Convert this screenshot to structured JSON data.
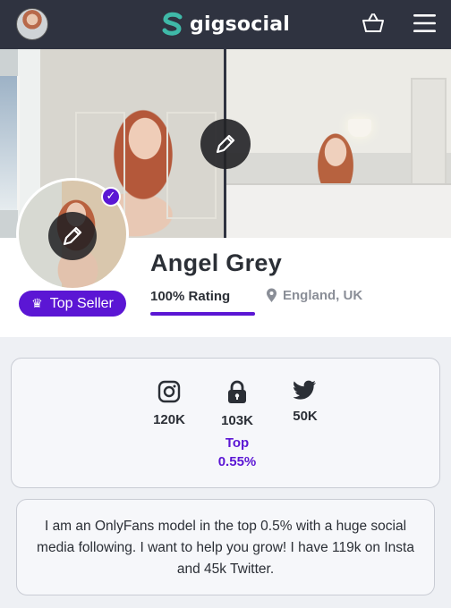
{
  "nav": {
    "brand": "gigsocial",
    "brand_colors": {
      "mark": "#3fb9a8",
      "bar": "#2f3340"
    },
    "avatar_icon": "user-avatar",
    "cart_icon": "basket-icon",
    "menu_icon": "hamburger-menu-icon"
  },
  "cover": {
    "edit_icon": "pencil-icon"
  },
  "profile": {
    "name": "Angel Grey",
    "badge": "Top Seller",
    "badge_icon": "crown-icon",
    "verified_icon": "check-icon",
    "rating_label": "100% Rating",
    "rating_fraction": 1.0,
    "location": "England, UK",
    "accent_color": "#5b16d4"
  },
  "stats": {
    "instagram": {
      "icon": "instagram-icon",
      "value": "120K"
    },
    "onlyfans": {
      "icon": "lock-icon",
      "value": "103K",
      "top_label": "Top",
      "top_value": "0.55%"
    },
    "twitter": {
      "icon": "twitter-icon",
      "value": "50K"
    }
  },
  "bio": {
    "text": "I am an OnlyFans model in the top 0.5% with a huge social media following. I want to help you grow! I have 119k on Insta and 45k Twitter."
  }
}
